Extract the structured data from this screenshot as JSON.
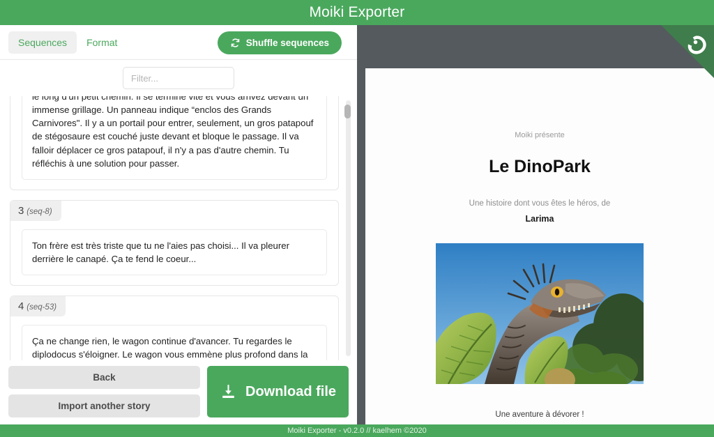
{
  "app": {
    "title": "Moiki Exporter",
    "footer": "Moiki Exporter - v0.2.0 // kaelhem ©2020",
    "colors": {
      "green": "#4aa85d",
      "dark_panel": "#545a5e",
      "ribbon_green": "#3f7d4c",
      "grey_button": "#e4e4e4"
    }
  },
  "left": {
    "tabs": [
      {
        "label": "Sequences",
        "active": true
      },
      {
        "label": "Format",
        "active": false
      }
    ],
    "shuffle_button": {
      "label": "Shuffle sequences",
      "icon": "shuffle-icon"
    },
    "filter": {
      "value": "",
      "placeholder": "Filter..."
    },
    "sequences": [
      {
        "number": "",
        "id": "",
        "clipped": true,
        "text": "le long d'un petit chemin. Il se termine vite et vous arrivez devant un immense grillage. Un panneau indique “enclos des Grands Carnivores\". Il y a un portail pour entrer, seulement, un gros patapouf de stégosaure est couché juste devant et bloque le passage. Il va falloir déplacer ce gros patapouf, il n'y a pas d'autre chemin. Tu réfléchis à une solution pour passer."
      },
      {
        "number": "3",
        "id": "(seq-8)",
        "clipped": false,
        "text": "Ton frère est très triste que tu ne l'aies pas choisi... Il va pleurer derrière le canapé. Ça te fend le coeur..."
      },
      {
        "number": "4",
        "id": "(seq-53)",
        "clipped": false,
        "text": "Ça ne change rien, le wagon continue d'avancer. Tu regardes le diplodocus s'éloigner. Le wagon vous emmène plus profond dans la jungle, vous devez souvent baisser la tête pour éviter les branches et les lianes. Vous voyez passer un groupe de ptérodactyles au-dessus"
      }
    ],
    "actions": {
      "back": "Back",
      "import": "Import another story",
      "download": "Download file",
      "download_icon": "download-icon"
    }
  },
  "preview": {
    "ribbon_icon": "moiki-logo-icon",
    "presents": "Moiki présente",
    "title": "Le DinoPark",
    "subtitle": "Une histoire dont vous êtes le héros, de",
    "author": "Larima",
    "cover_alt": "dinosaur-cover-image",
    "caption": "Une aventure à dévorer !"
  }
}
